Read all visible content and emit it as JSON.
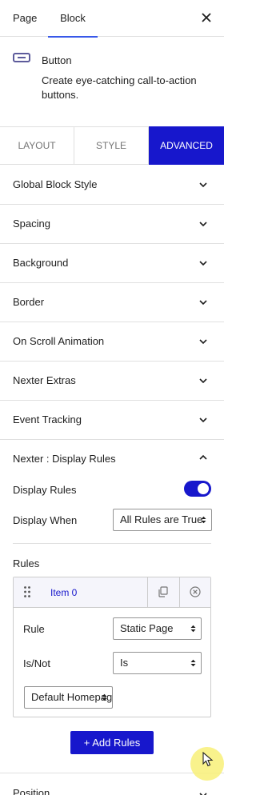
{
  "tabs": {
    "page": "Page",
    "block": "Block"
  },
  "block_card": {
    "icon": "button-block-icon",
    "title": "Button",
    "description": "Create eye-catching call-to-action buttons."
  },
  "mode_tabs": {
    "layout": "LAYOUT",
    "style": "STYLE",
    "advanced": "ADVANCED"
  },
  "panels": [
    "Global Block Style",
    "Spacing",
    "Background",
    "Border",
    "On Scroll Animation",
    "Nexter Extras",
    "Event Tracking"
  ],
  "display_rules": {
    "header": "Nexter : Display Rules",
    "display_rules_label": "Display Rules",
    "display_rules_enabled": true,
    "display_when_label": "Display When",
    "display_when_value": "All Rules are True",
    "rules_label": "Rules",
    "item": {
      "title": "Item 0",
      "rule_label": "Rule",
      "rule_value": "Static Page",
      "isnot_label": "Is/Not",
      "isnot_value": "Is",
      "page_value": "Default Homepage"
    },
    "add_button": "+ Add Rules"
  },
  "position_panel": "Position",
  "colors": {
    "accent": "#1717cc",
    "tab_underline": "#3858e9",
    "icon": "#5d5b9b"
  }
}
